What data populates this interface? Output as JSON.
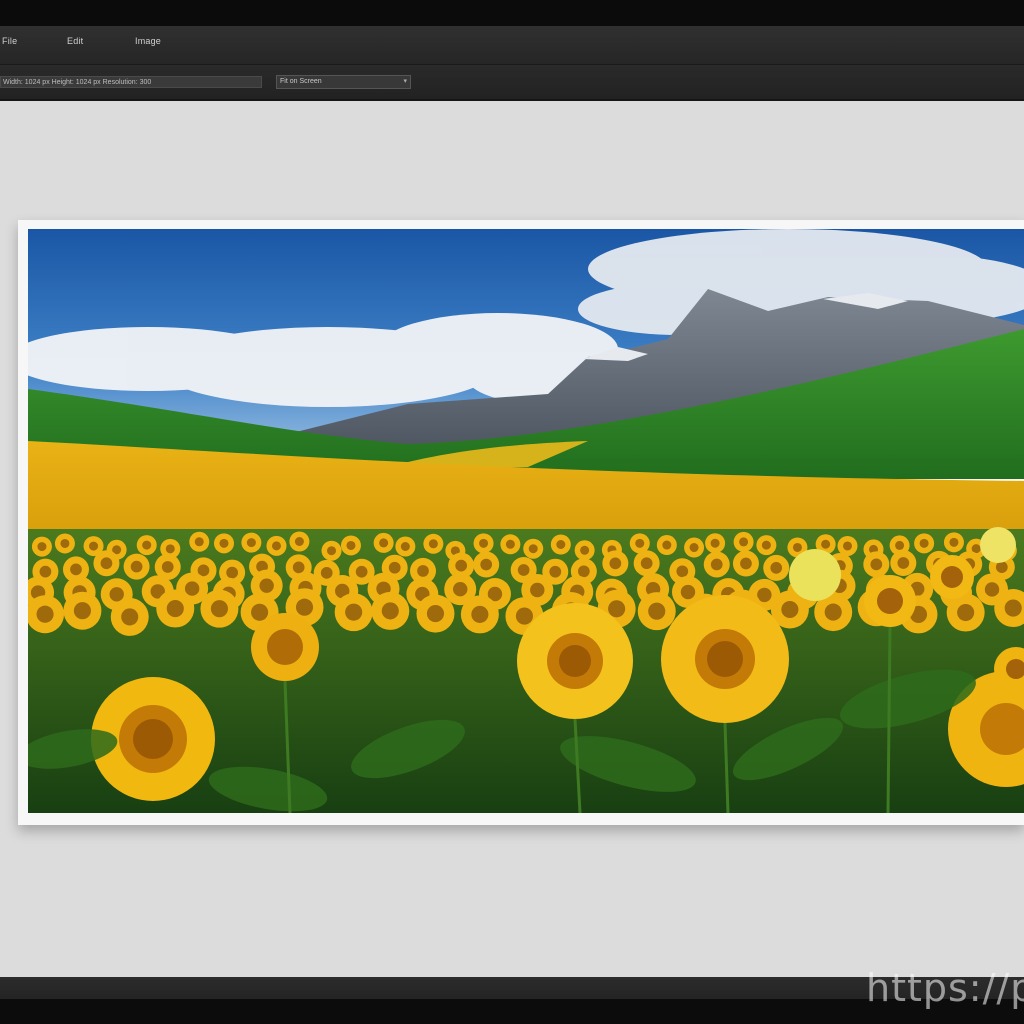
{
  "menubar": {
    "items": [
      "File",
      "Edit",
      "Image"
    ]
  },
  "options_bar": {
    "field_value": "Width: 1024 px  Height: 1024 px  Resolution: 300",
    "select_value": "Fit on Screen"
  },
  "canvas": {
    "image_subject": "sunflower field with green hills and mountains under blue sky"
  },
  "watermark": {
    "text": "https://pr"
  },
  "colors": {
    "sky_top": "#1f5fae",
    "sky_bottom": "#4f8fd0",
    "field_yellow": "#e8b312",
    "hill_green": "#2f8a2a",
    "workspace_bg": "#dcdcdc",
    "chrome_dark": "#262626"
  }
}
